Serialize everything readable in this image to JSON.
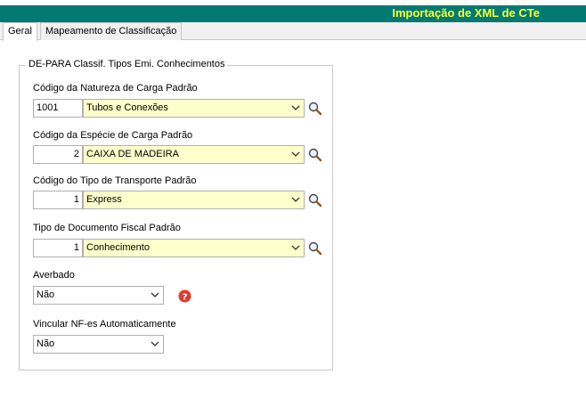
{
  "window": {
    "title": "Importação de XML de CTe",
    "accent": "#007a73",
    "title_color": "#ffff33"
  },
  "tabs": [
    {
      "label": "Geral",
      "active": true
    },
    {
      "label": "Mapeamento de Classificação",
      "active": false
    }
  ],
  "group": {
    "legend": "DE-PARA Classif. Tipos Emi. Conhecimentos",
    "natureza": {
      "label": "Código da Natureza de Carga Padrão",
      "code": "1001",
      "value": "Tubos e Conexões"
    },
    "especie": {
      "label": "Código da Espécie de Carga Padrão",
      "code": "2",
      "value": "CAIXA DE MADEIRA"
    },
    "transporte": {
      "label": "Código do Tipo de Transporte Padrão",
      "code": "1",
      "value": "Express"
    },
    "documento": {
      "label": "Tipo de Documento Fiscal Padrão",
      "code": "1",
      "value": "Conhecimento"
    },
    "averbado": {
      "label": "Averbado",
      "value": "Não"
    },
    "vincular": {
      "label": "Vincular NF-es Automaticamente",
      "value": "Não"
    }
  },
  "icons": {
    "lookup": "magnifier-icon",
    "dropdown": "chevron-down-icon",
    "help": "question-icon"
  },
  "colors": {
    "combo_bg": "#ffffcc",
    "help": "#e03c2c"
  }
}
